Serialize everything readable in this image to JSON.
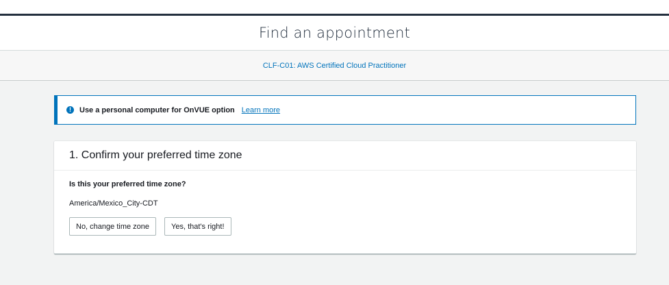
{
  "header": {
    "title": "Find an appointment"
  },
  "exam": {
    "link_text": "CLF-C01: AWS Certified Cloud Practitioner"
  },
  "alert": {
    "icon": "info-icon",
    "icon_glyph": "!",
    "message": "Use a personal computer for OnVUE option",
    "link_text": "Learn more"
  },
  "timezone_card": {
    "title": "1. Confirm your preferred time zone",
    "question": "Is this your preferred time zone?",
    "current_timezone": "America/Mexico_City-CDT",
    "change_button": "No, change time zone",
    "confirm_button": "Yes, that's right!"
  },
  "colors": {
    "accent": "#0073bb",
    "nav_dark": "#232f3e",
    "background": "#f2f3f3"
  }
}
